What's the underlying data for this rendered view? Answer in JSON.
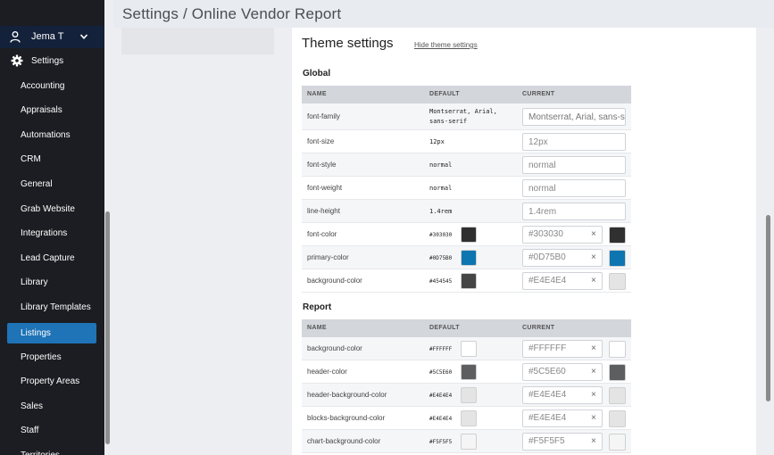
{
  "sidebar": {
    "user_name": "Jema T",
    "settings_label": "Settings",
    "items": [
      {
        "label": "Accounting"
      },
      {
        "label": "Appraisals"
      },
      {
        "label": "Automations"
      },
      {
        "label": "CRM"
      },
      {
        "label": "General"
      },
      {
        "label": "Grab Website"
      },
      {
        "label": "Integrations"
      },
      {
        "label": "Lead Capture"
      },
      {
        "label": "Library"
      },
      {
        "label": "Library Templates"
      },
      {
        "label": "Listings",
        "active": true
      },
      {
        "label": "Properties"
      },
      {
        "label": "Property Areas"
      },
      {
        "label": "Sales"
      },
      {
        "label": "Staff"
      },
      {
        "label": "Territories"
      }
    ]
  },
  "header": {
    "breadcrumb": "Settings / Online Vendor Report"
  },
  "theme": {
    "title": "Theme settings",
    "hide_link": "Hide theme settings"
  },
  "columns": {
    "name": "NAME",
    "default": "DEFAULT",
    "current": "CURRENT"
  },
  "global": {
    "title": "Global",
    "rows": [
      {
        "name": "font-family",
        "default": "Montserrat, Arial, sans-serif",
        "current": "Montserrat, Arial, sans-serif"
      },
      {
        "name": "font-size",
        "default": "12px",
        "current": "12px"
      },
      {
        "name": "font-style",
        "default": "normal",
        "current": "normal"
      },
      {
        "name": "font-weight",
        "default": "normal",
        "current": "normal"
      },
      {
        "name": "line-height",
        "default": "1.4rem",
        "current": "1.4rem"
      },
      {
        "name": "font-color",
        "default": "#303030",
        "current": "#303030",
        "color": "#303030"
      },
      {
        "name": "primary-color",
        "default": "#0D75B0",
        "current": "#0D75B0",
        "color": "#0D75B0"
      },
      {
        "name": "background-color",
        "default": "#454545",
        "current": "#E4E4E4",
        "default_color": "#454545",
        "color": "#E4E4E4"
      }
    ]
  },
  "report": {
    "title": "Report",
    "rows": [
      {
        "name": "background-color",
        "default": "#FFFFFF",
        "current": "#FFFFFF",
        "color": "#FFFFFF"
      },
      {
        "name": "header-color",
        "default": "#5C5E60",
        "current": "#5C5E60",
        "color": "#5C5E60"
      },
      {
        "name": "header-background-color",
        "default": "#E4E4E4",
        "current": "#E4E4E4",
        "color": "#E4E4E4"
      },
      {
        "name": "blocks-background-color",
        "default": "#E4E4E4",
        "current": "#E4E4E4",
        "color": "#E4E4E4"
      },
      {
        "name": "chart-background-color",
        "default": "#F5F5F5",
        "current": "#F5F5F5",
        "color": "#F5F5F5"
      }
    ]
  },
  "clear_symbol": "×"
}
